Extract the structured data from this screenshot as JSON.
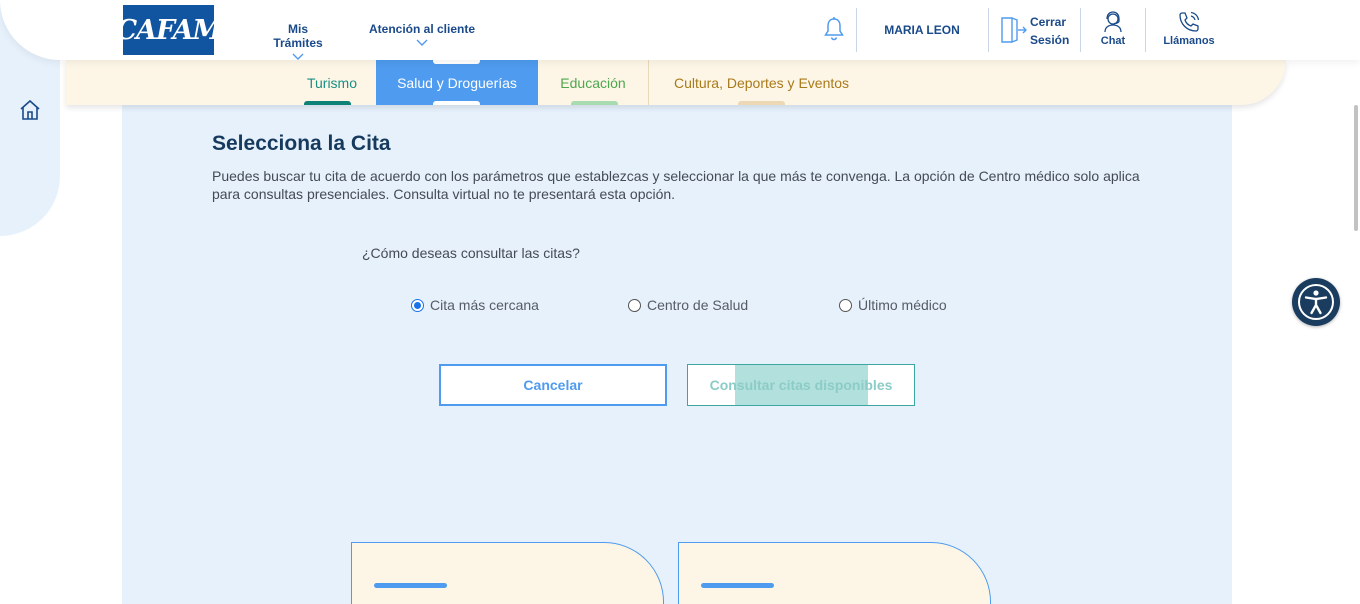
{
  "header": {
    "logo_text": "CAFAM",
    "nav": [
      {
        "label": "Mis Trámites"
      },
      {
        "label": "Atención al cliente"
      }
    ],
    "user_name": "MARIA LEON",
    "logout_label_line1": "Cerrar",
    "logout_label_line2": "Sesión",
    "chat_label": "Chat",
    "call_label": "Llámanos",
    "icons": [
      "bell-icon",
      "logout-icon",
      "chat-agent-icon",
      "phone-icon"
    ]
  },
  "tabs": [
    {
      "label": "Turismo",
      "color": "#0e8277"
    },
    {
      "label": "Salud y Droguerías",
      "color": "#4f9bef",
      "active": true
    },
    {
      "label": "Educación",
      "color": "#4fa64f"
    },
    {
      "label": "Cultura, Deportes y Eventos",
      "color": "#a97a1a"
    }
  ],
  "main": {
    "title": "Selecciona la Cita",
    "description": "Puedes buscar tu cita de acuerdo con los parámetros que establezcas y seleccionar la que más te convenga. La opción de Centro médico solo aplica para consultas presenciales. Consulta virtual no te presentará esta opción.",
    "question": "¿Cómo deseas consultar las citas?",
    "options": [
      {
        "label": "Cita más cercana",
        "selected": true
      },
      {
        "label": "Centro de Salud",
        "selected": false
      },
      {
        "label": "Último médico",
        "selected": false
      }
    ],
    "cancel_label": "Cancelar",
    "submit_label": "Consultar citas disponibles"
  },
  "colors": {
    "primary": "#4f9bef",
    "navy": "#1a4a8a",
    "panel_bg": "#e6f1fc",
    "tabs_bg": "#fdf6e7",
    "teal": "#3ba7a0"
  }
}
